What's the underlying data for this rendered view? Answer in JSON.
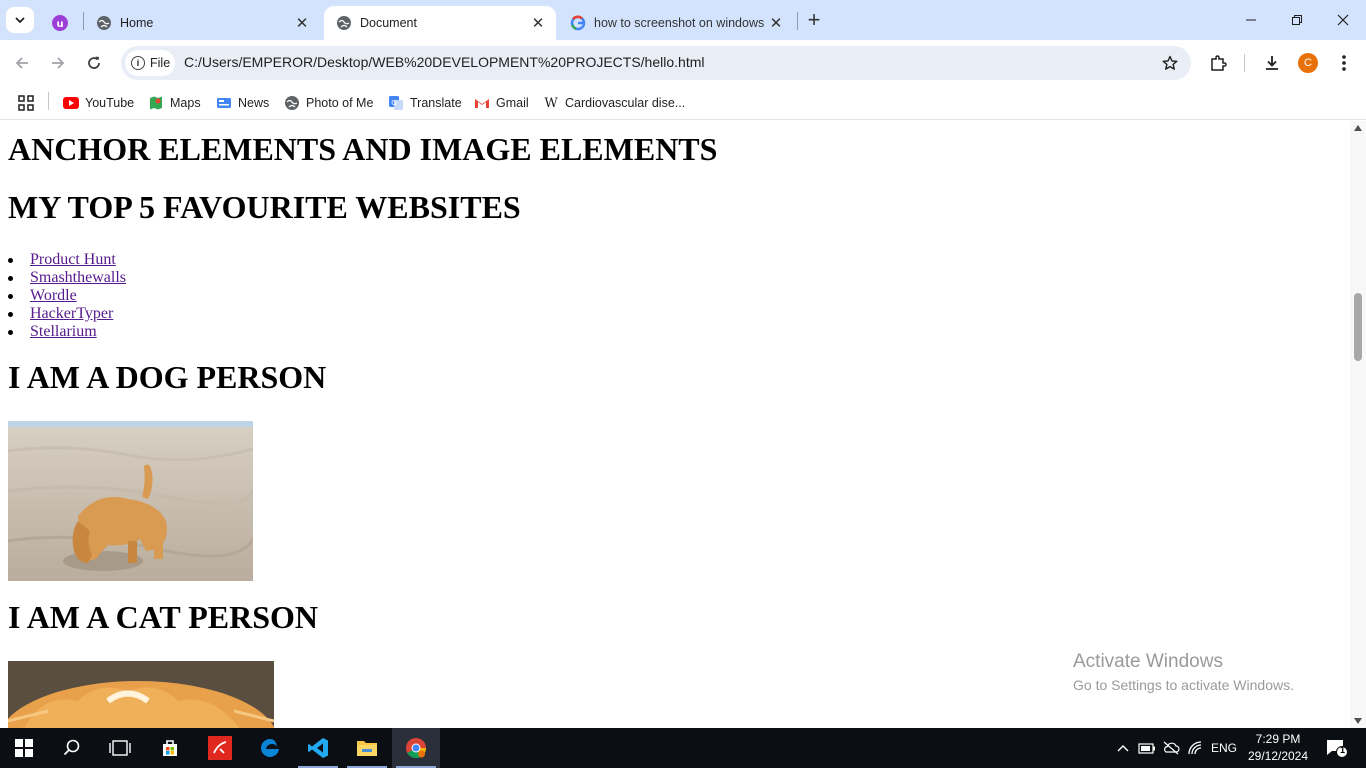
{
  "browser": {
    "tabs": [
      {
        "title": "",
        "icon": "purple-app-icon"
      },
      {
        "title": "Home",
        "icon": "globe-icon"
      },
      {
        "title": "Document",
        "icon": "globe-icon",
        "active": true
      },
      {
        "title": "how to screenshot on windows",
        "icon": "google-icon"
      }
    ],
    "address": {
      "chip": "File",
      "url": "C:/Users/EMPEROR/Desktop/WEB%20DEVELOPMENT%20PROJECTS/hello.html"
    },
    "profile_initial": "C",
    "bookmarks": [
      "YouTube",
      "Maps",
      "News",
      "Photo of Me",
      "Translate",
      "Gmail",
      "Cardiovascular dise..."
    ]
  },
  "page": {
    "heading1": "ANCHOR ELEMENTS AND IMAGE ELEMENTS",
    "heading2": "MY TOP 5 FAVOURITE WEBSITES",
    "links": [
      "Product Hunt",
      "Smashthewalls",
      "Wordle",
      "HackerTyper",
      "Stellarium"
    ],
    "heading3": "I AM A DOG PERSON",
    "heading4": "I AM A CAT PERSON"
  },
  "watermark": {
    "line1": "Activate Windows",
    "line2": "Go to Settings to activate Windows."
  },
  "taskbar": {
    "language": "ENG",
    "time": "7:29 PM",
    "date": "29/12/2024",
    "notification_count": "1"
  }
}
